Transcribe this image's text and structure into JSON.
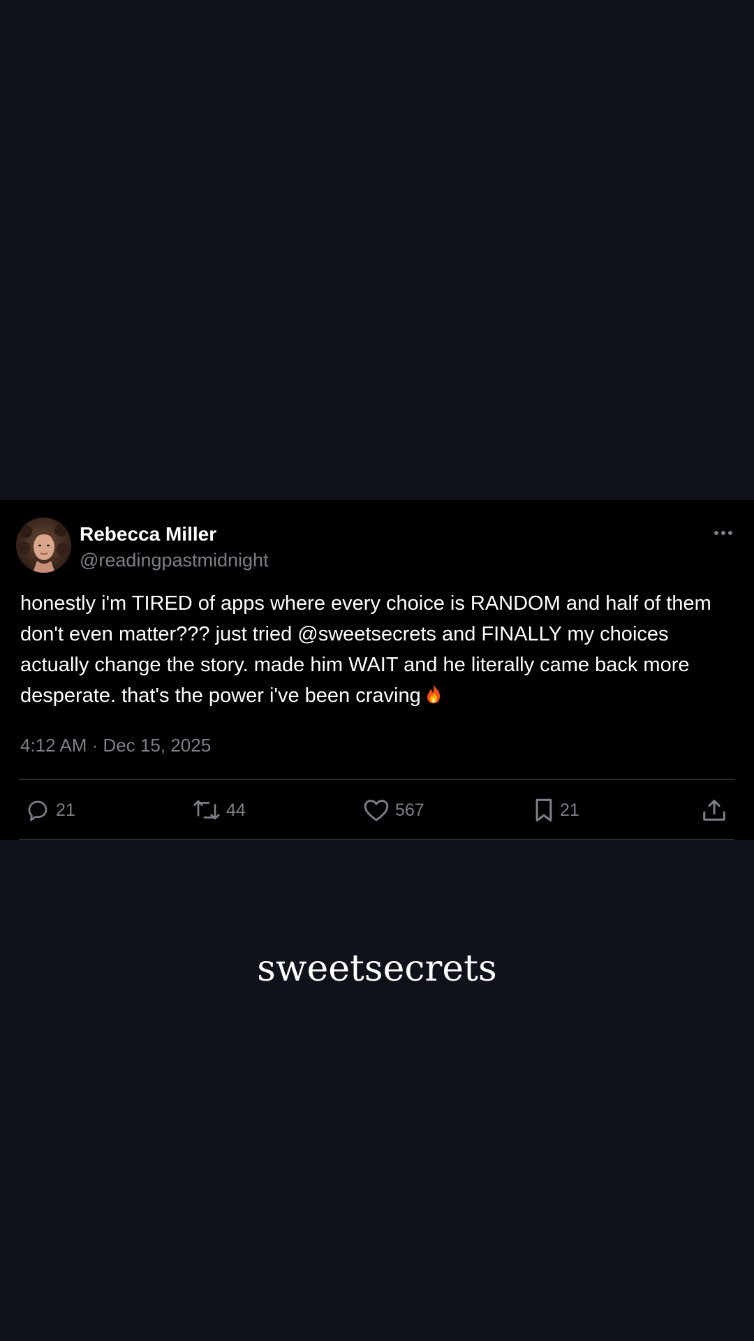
{
  "tweet": {
    "author_name": "Rebecca Miller",
    "author_handle": "@readingpastmidnight",
    "text": "honestly i'm TIRED of apps where every choice is RANDOM and half of them don't even matter??? just tried @sweetsecrets and FINALLY my choices actually change the story. made him WAIT and he literally came back more desperate. that's the power i've been craving",
    "emoji": "fire",
    "timestamp": "4:12 AM · Dec 15, 2025",
    "actions": {
      "reply_count": "21",
      "retweet_count": "44",
      "like_count": "567",
      "bookmark_count": "21"
    },
    "icons": {
      "more": "more-horizontal-icon",
      "reply": "reply-icon",
      "retweet": "retweet-icon",
      "like": "heart-icon",
      "bookmark": "bookmark-icon",
      "share": "share-icon"
    }
  },
  "brand": {
    "name": "sweetsecrets"
  },
  "colors": {
    "page_background": "#0f121a",
    "card_background": "#000000",
    "primary_text": "#ffffff",
    "secondary_text": "#7b8088",
    "divider": "#2a2e35"
  }
}
